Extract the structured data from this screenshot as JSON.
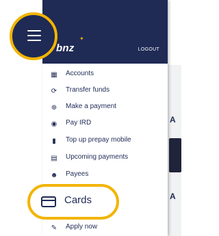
{
  "brand": {
    "logo_text": "bnz",
    "star": "✦"
  },
  "header": {
    "logout_label": "LOGOUT"
  },
  "menu": {
    "items": [
      {
        "label": "Accounts",
        "icon": "accounts-icon",
        "glyph": "▦"
      },
      {
        "label": "Transfer funds",
        "icon": "transfer-icon",
        "glyph": "⟳"
      },
      {
        "label": "Make a payment",
        "icon": "payment-icon",
        "glyph": "⊕"
      },
      {
        "label": "Pay IRD",
        "icon": "ird-icon",
        "glyph": "◉"
      },
      {
        "label": "Top up prepay mobile",
        "icon": "mobile-icon",
        "glyph": "▮"
      },
      {
        "label": "Upcoming payments",
        "icon": "calendar-icon",
        "glyph": "▤"
      },
      {
        "label": "Payees",
        "icon": "payees-icon",
        "glyph": "☻"
      },
      {
        "label": "Cards",
        "icon": "card-icon"
      },
      {
        "label": "Apply now",
        "icon": "edit-icon",
        "glyph": "✎"
      }
    ]
  },
  "background": {
    "letters": [
      "A",
      "A"
    ]
  },
  "colors": {
    "navy": "#1f2a55",
    "highlight": "#f2b400"
  }
}
